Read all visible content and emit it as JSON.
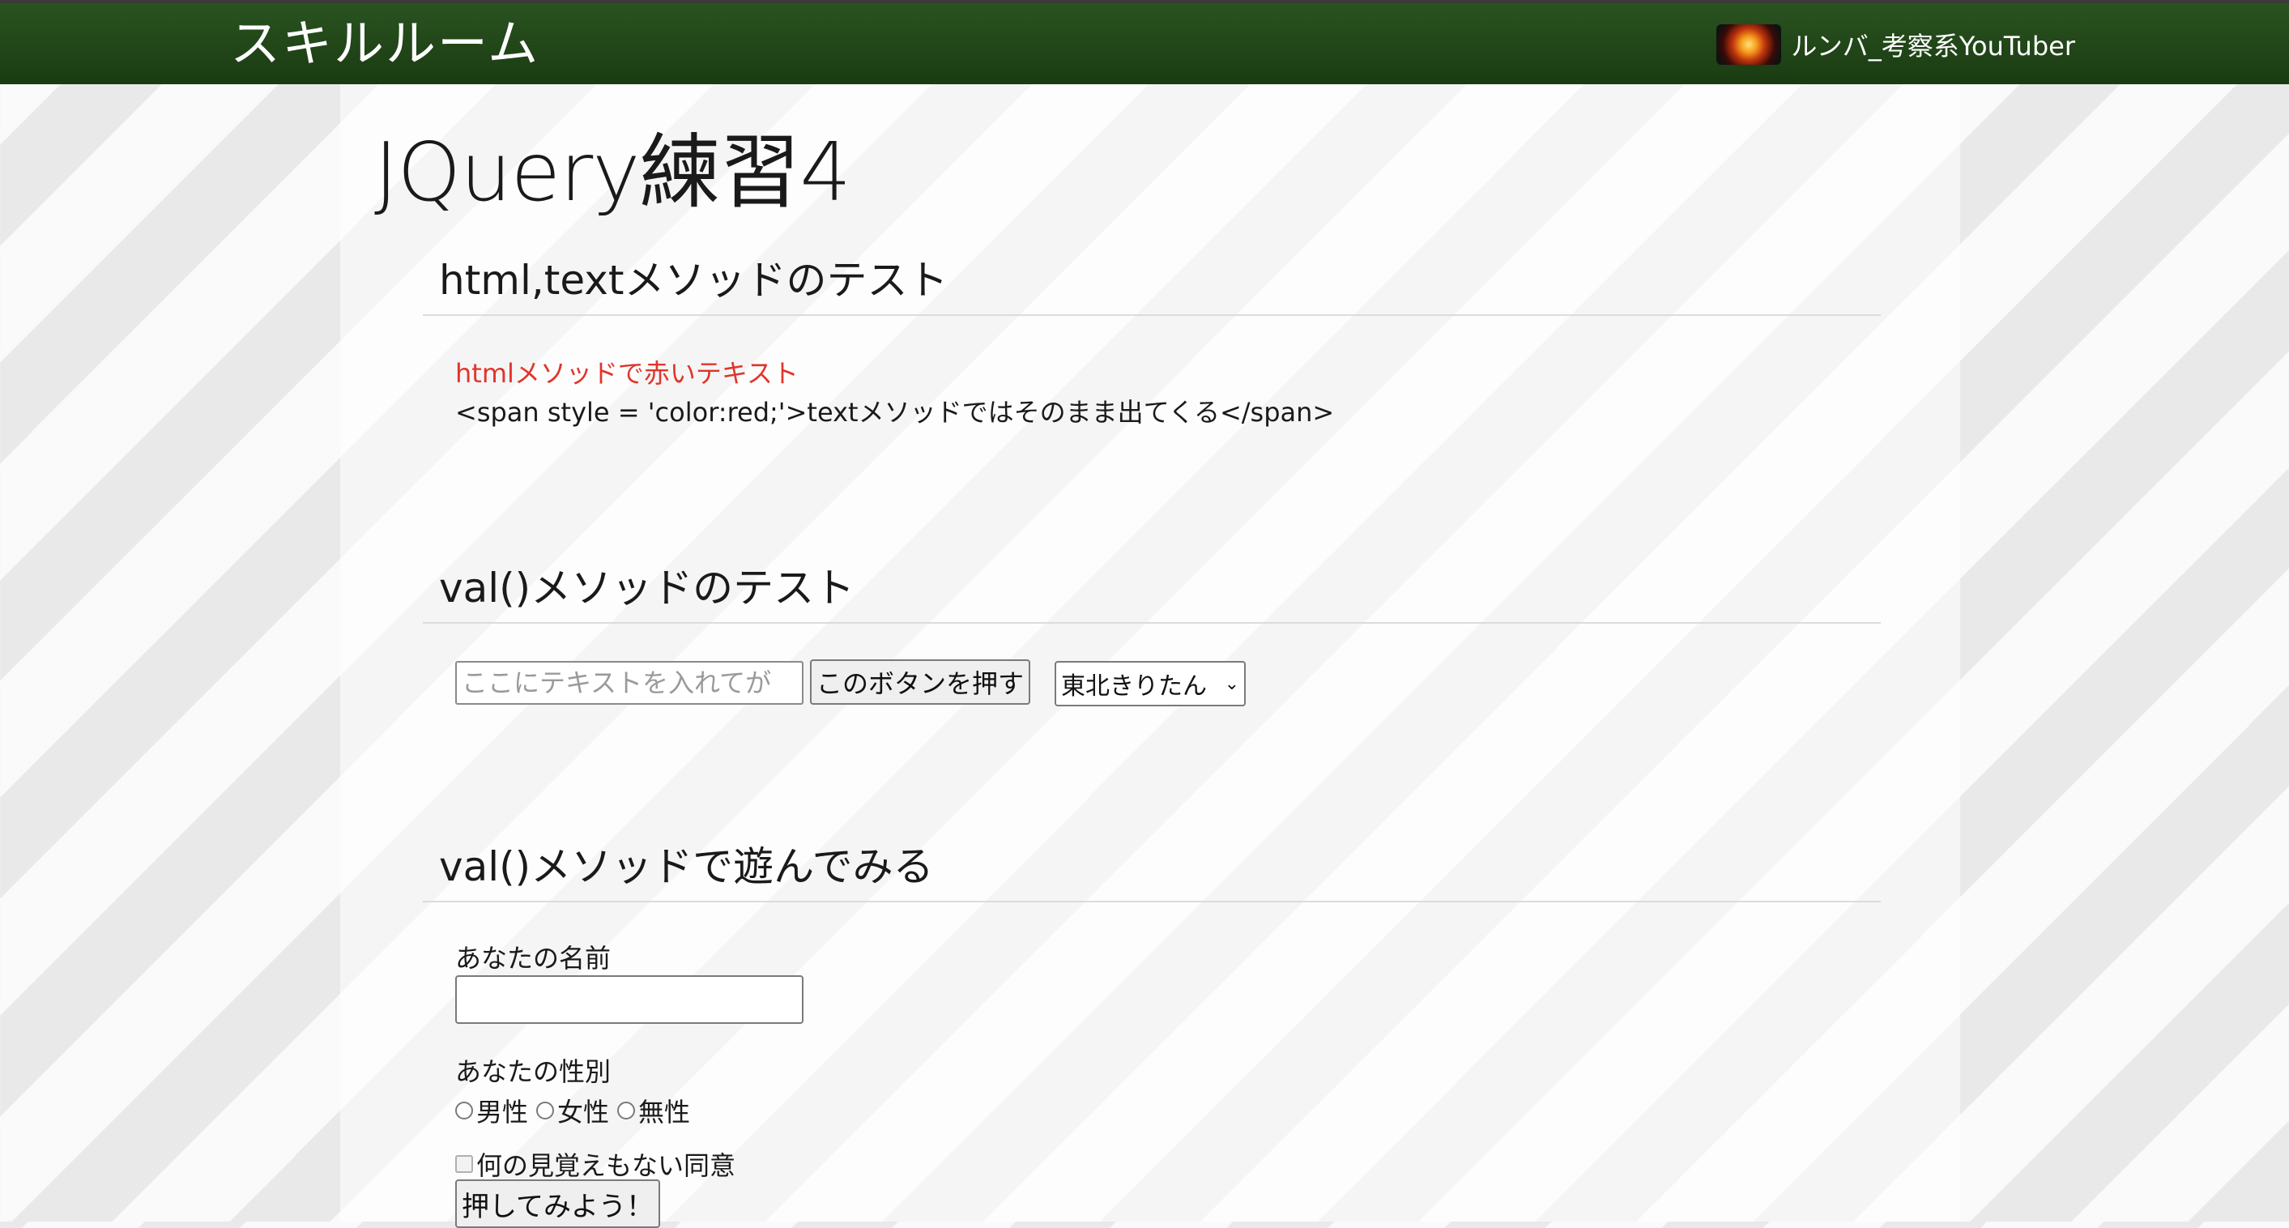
{
  "header": {
    "site_title": "スキルルーム",
    "user_name": "ルンバ_考察系YouTuber",
    "avatar_icon": "avatar-image"
  },
  "page": {
    "title": "JQuery練習4"
  },
  "section1": {
    "heading": "html,textメソッドのテスト",
    "html_text": "htmlメソッドで赤いテキスト",
    "text_text": "<span style = 'color:red;'>textメソッドではそのまま出てくる</span>"
  },
  "section2": {
    "heading": "val()メソッドのテスト",
    "input_placeholder": "ここにテキストを入れてが",
    "button_label": "このボタンを押す",
    "select_value": "東北きりたん"
  },
  "section3": {
    "heading": "val()メソッドで遊んでみる",
    "name_label": "あなたの名前",
    "gender_label": "あなたの性別",
    "gender_options": [
      "男性",
      "女性",
      "無性"
    ],
    "agree_label": "何の見覚えもない同意",
    "submit_label": "押してみよう！"
  },
  "colors": {
    "header_bg": "#1e4416",
    "red_text": "#e0352b"
  }
}
